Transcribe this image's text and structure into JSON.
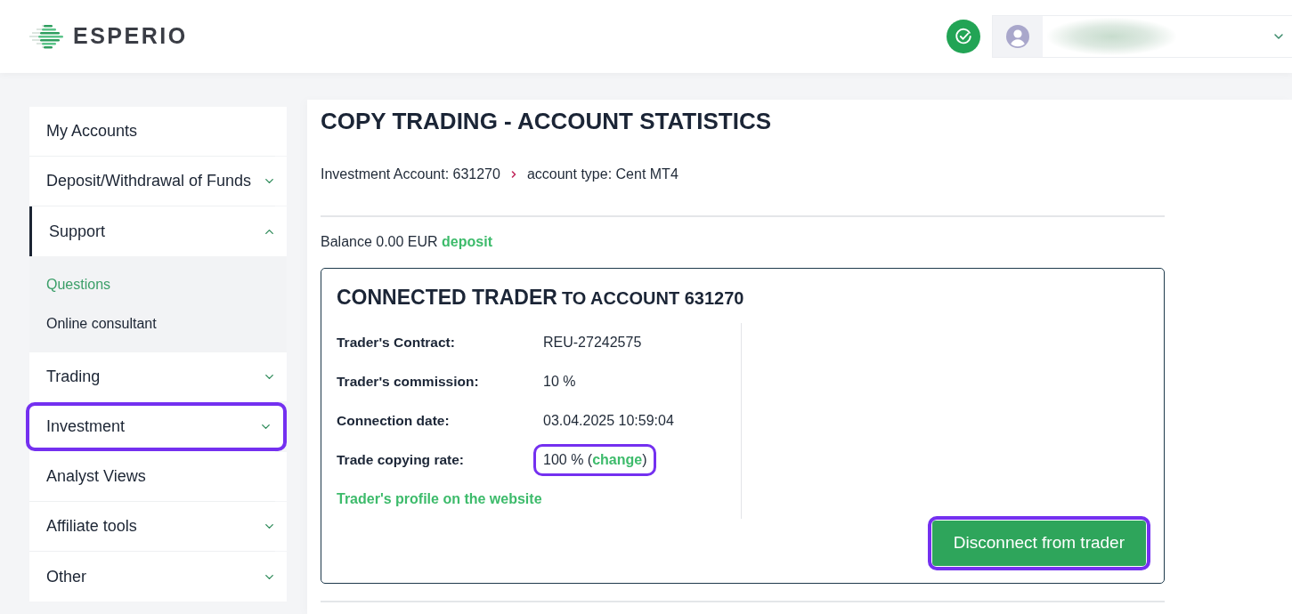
{
  "header": {
    "logo_text": "ESPERIO"
  },
  "sidebar": {
    "items": [
      {
        "label": "My Accounts",
        "kind": "link",
        "selected": false,
        "highlighted": false
      },
      {
        "label": "Deposit/Withdrawal of Funds",
        "kind": "group",
        "expanded": false,
        "selected": false,
        "highlighted": false
      },
      {
        "label": "Support",
        "kind": "group",
        "expanded": true,
        "selected": true,
        "highlighted": false,
        "children": [
          {
            "label": "Questions",
            "selected": true
          },
          {
            "label": "Online consultant",
            "selected": false
          }
        ]
      },
      {
        "label": "Trading",
        "kind": "group",
        "expanded": false,
        "selected": false,
        "highlighted": false
      },
      {
        "label": "Investment",
        "kind": "group",
        "expanded": false,
        "selected": false,
        "highlighted": true
      },
      {
        "label": "Analyst Views",
        "kind": "link",
        "selected": false,
        "highlighted": false
      },
      {
        "label": "Affiliate tools",
        "kind": "group",
        "expanded": false,
        "selected": false,
        "highlighted": false
      },
      {
        "label": "Other",
        "kind": "group",
        "expanded": false,
        "selected": false,
        "highlighted": false
      }
    ]
  },
  "page": {
    "title": "COPY TRADING - ACCOUNT STATISTICS",
    "breadcrumb": [
      "Investment Account: 631270",
      "account type: Cent MT4"
    ],
    "balance": {
      "text": "Balance 0.00 EUR",
      "link": "deposit"
    }
  },
  "trader_card": {
    "title": "CONNECTED TRADER",
    "subtitle": "TO ACCOUNT 631270",
    "fields": [
      {
        "label": "Trader's Contract:",
        "value": "REU-27242575",
        "highlighted": false
      },
      {
        "label": "Trader's commission:",
        "value": "10 %",
        "highlighted": false
      },
      {
        "label": "Connection date:",
        "value": "03.04.2025 10:59:04",
        "highlighted": false
      },
      {
        "label": "Trade copying rate:",
        "value": "100 % (",
        "link": "change",
        "value_end": ")",
        "highlighted": true
      }
    ],
    "profile_link": "Trader's profile on the website",
    "button": {
      "label": "Disconnect from trader",
      "highlighted": true
    }
  }
}
